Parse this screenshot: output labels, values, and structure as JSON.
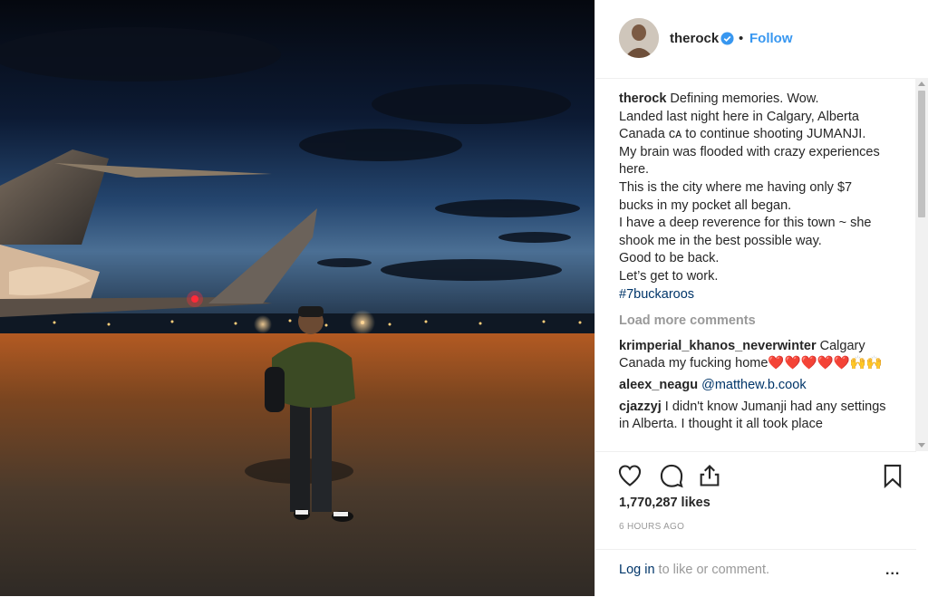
{
  "header": {
    "username": "therock",
    "separator": "•",
    "follow_label": "Follow"
  },
  "caption": {
    "username": "therock",
    "lines": [
      "Defining memories. Wow.",
      "Landed last night here in Calgary, Alberta",
      "Canada ᴄᴀ to continue shooting JUMANJI.",
      "My brain was flooded with crazy experiences",
      "here.",
      "This is the city where me having only $7",
      "bucks in my pocket all began.",
      "I have a deep reverence for this town ~ she",
      "shook me in the best possible way.",
      "Good to be back.",
      "Let’s get to work."
    ],
    "hashtag": "#7buckaroos"
  },
  "load_more_label": "Load more comments",
  "comments": [
    {
      "username": "krimperial_khanos_neverwinter",
      "text": "Calgary Canada my fucking home❤️❤️❤️❤️❤️🙌🙌"
    },
    {
      "username": "aleex_neagu",
      "mention": "@matthew.b.cook"
    },
    {
      "username": "cjazzyj",
      "text": "I didn't know Jumanji had any settings in Alberta. I thought it all took place"
    }
  ],
  "actions": {
    "like_icon": "heart-icon",
    "comment_icon": "comment-icon",
    "share_icon": "share-icon",
    "save_icon": "bookmark-icon"
  },
  "likes_text": "1,770,287 likes",
  "time_text": "6 HOURS AGO",
  "footer": {
    "login_link": "Log in",
    "login_rest": " to like or comment.",
    "more_label": "..."
  },
  "colors": {
    "link_blue": "#3897f0",
    "dark_link": "#003569",
    "muted": "#999999",
    "text": "#262626"
  }
}
